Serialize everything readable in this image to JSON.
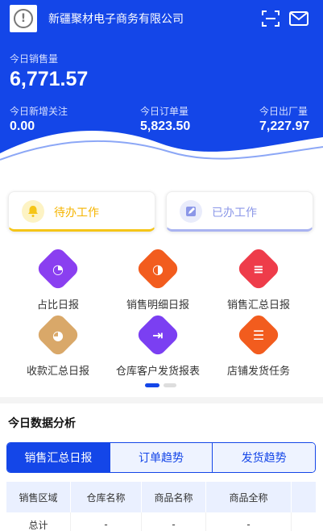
{
  "header": {
    "company": "新疆聚材电子商务有限公司",
    "icons": [
      "info-icon",
      "scan-icon",
      "mail-icon"
    ]
  },
  "stats": {
    "sales_label": "今日销售量",
    "sales_value": "6,771.57",
    "follow_label": "今日新增关注",
    "follow_value": "0.00",
    "orders_label": "今日订单量",
    "orders_value": "5,823.50",
    "shipped_label": "今日出厂量",
    "shipped_value": "7,227.97"
  },
  "work_tabs": [
    {
      "label": "待办工作",
      "icon": "bell-icon",
      "color": "#f5c518"
    },
    {
      "label": "已办工作",
      "icon": "edit-icon",
      "color": "#8b97e8"
    }
  ],
  "grid": [
    {
      "label": "占比日报",
      "icon": "pie-chart-icon",
      "color": "#8a3ff0"
    },
    {
      "label": "销售明细日报",
      "icon": "donut-chart-icon",
      "color": "#f25c1e"
    },
    {
      "label": "销售汇总日报",
      "icon": "receipt-icon",
      "color": "#ee3c4a"
    },
    {
      "label": "收款汇总日报",
      "icon": "payment-pie-icon",
      "color": "#d9a869"
    },
    {
      "label": "仓库客户发货报表",
      "icon": "warehouse-icon",
      "color": "#7b3ff2"
    },
    {
      "label": "店铺发货任务",
      "icon": "task-icon",
      "color": "#f25c1e"
    }
  ],
  "analysis": {
    "title": "今日数据分析",
    "tabs": [
      "销售汇总日报",
      "订单趋势",
      "发货趋势"
    ],
    "columns": [
      "销售区域",
      "仓库名称",
      "商品名称",
      "商品全称"
    ],
    "rows": [
      [
        "总计",
        "-",
        "-",
        "-"
      ]
    ]
  }
}
